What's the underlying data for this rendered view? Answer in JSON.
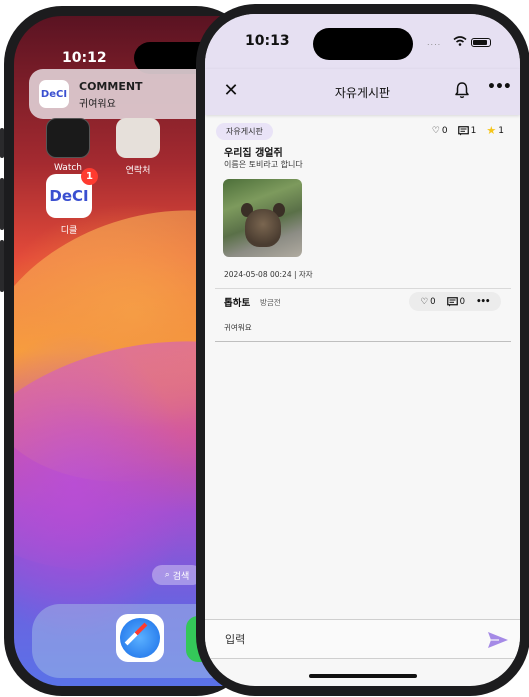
{
  "back_phone": {
    "time": "10:12",
    "notification": {
      "app_icon_text": "DeCI",
      "title": "COMMENT",
      "body": "귀여워요"
    },
    "apps": {
      "watch_label": "Watch",
      "contacts_label": "연락처",
      "deci_label": "디클",
      "deci_icon_text": "DeCI",
      "deci_badge": "1"
    },
    "search_label": "검색",
    "dock_icons": [
      "safari-icon",
      "green-app-icon"
    ]
  },
  "front_phone": {
    "time": "10:13",
    "colors": {
      "header_bg": "#e6e0f2",
      "accent": "#9a7be0",
      "star": "#f5c518"
    },
    "navbar": {
      "title": "자유게시판",
      "icons": [
        "close-icon",
        "bell-icon",
        "more-icon"
      ]
    },
    "post": {
      "tag": "자유게시판",
      "likes": "0",
      "comments": "1",
      "stars": "1",
      "title": "우리집 갱얼쥐",
      "body": "이름은 토비라고 합니다",
      "meta": "2024-05-08 00:24 | 자자"
    },
    "comment": {
      "author": "톱하토",
      "time": "방금전",
      "likes": "0",
      "replies": "0",
      "body": "귀여워요"
    },
    "input": {
      "placeholder": "입력"
    }
  }
}
